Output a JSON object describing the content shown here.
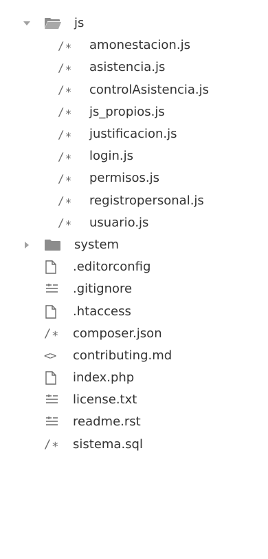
{
  "tree": {
    "js_folder": {
      "label": "js",
      "expanded": true,
      "children": [
        {
          "label": "amonestacion.js",
          "icon": "js-comment-icon",
          "glyph": "/∗"
        },
        {
          "label": "asistencia.js",
          "icon": "js-comment-icon",
          "glyph": "/∗"
        },
        {
          "label": "controlAsistencia.js",
          "icon": "js-comment-icon",
          "glyph": "/∗"
        },
        {
          "label": "js_propios.js",
          "icon": "js-comment-icon",
          "glyph": "/∗"
        },
        {
          "label": "justificacion.js",
          "icon": "js-comment-icon",
          "glyph": "/∗"
        },
        {
          "label": "login.js",
          "icon": "js-comment-icon",
          "glyph": "/∗"
        },
        {
          "label": "permisos.js",
          "icon": "js-comment-icon",
          "glyph": "/∗"
        },
        {
          "label": "registropersonal.js",
          "icon": "js-comment-icon",
          "glyph": "/∗"
        },
        {
          "label": "usuario.js",
          "icon": "js-comment-icon",
          "glyph": "/∗"
        }
      ]
    },
    "system_folder": {
      "label": "system",
      "expanded": false
    },
    "root_files": [
      {
        "label": ".editorconfig",
        "icon": "file-icon",
        "glyph": ""
      },
      {
        "label": ".gitignore",
        "icon": "text-lines-icon",
        "glyph": ""
      },
      {
        "label": ".htaccess",
        "icon": "file-icon",
        "glyph": ""
      },
      {
        "label": "composer.json",
        "icon": "json-comment-icon",
        "glyph": "/∗"
      },
      {
        "label": "contributing.md",
        "icon": "code-brackets-icon",
        "glyph": "<>"
      },
      {
        "label": "index.php",
        "icon": "file-icon",
        "glyph": ""
      },
      {
        "label": "license.txt",
        "icon": "text-lines-icon",
        "glyph": ""
      },
      {
        "label": "readme.rst",
        "icon": "text-lines-icon",
        "glyph": ""
      },
      {
        "label": "sistema.sql",
        "icon": "sql-comment-icon",
        "glyph": "/∗"
      }
    ]
  },
  "colors": {
    "icon_gray": "#6b6b6b",
    "folder_gray": "#8c8c8c",
    "text": "#333333",
    "background": "#ffffff"
  }
}
